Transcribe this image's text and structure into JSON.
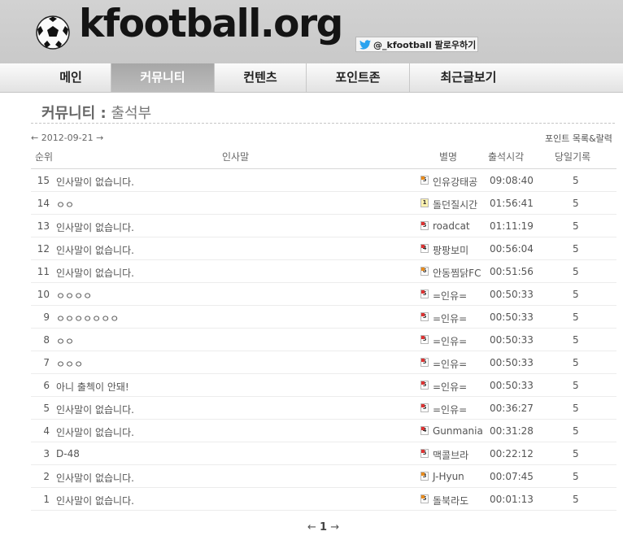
{
  "site": {
    "logo_text": "kfootball.org",
    "twitter_label": "@_kfootball 팔로우하기"
  },
  "nav": [
    {
      "label": "메인",
      "active": false
    },
    {
      "label": "커뮤니티",
      "active": true
    },
    {
      "label": "컨텐츠",
      "active": false
    },
    {
      "label": "포인트존",
      "active": false
    },
    {
      "label": "최근글보기",
      "active": false
    }
  ],
  "page": {
    "title_section": "커뮤니티 :",
    "title_page": "출석부",
    "date_nav": "← 2012-09-21 →",
    "point_link": "포인트 목록&랄력"
  },
  "table": {
    "headers": {
      "rank": "순위",
      "greeting": "인사말",
      "nickname": "별명",
      "time": "출석시각",
      "count": "당일기록"
    },
    "rows": [
      {
        "rank": "15",
        "greeting": "인사말이 없습니다.",
        "level": "5",
        "nickname": "인유강태공",
        "time": "09:08:40",
        "count": "5"
      },
      {
        "rank": "14",
        "greeting": "ㅇㅇ",
        "level": "1",
        "nickname": "돌던질시간",
        "time": "01:56:41",
        "count": "5"
      },
      {
        "rank": "13",
        "greeting": "인사말이 없습니다.",
        "level": "5",
        "nickname": "roadcat",
        "time": "01:11:19",
        "count": "5"
      },
      {
        "rank": "12",
        "greeting": "인사말이 없습니다.",
        "level": "4",
        "nickname": "팡팡보미",
        "time": "00:56:04",
        "count": "5"
      },
      {
        "rank": "11",
        "greeting": "인사말이 없습니다.",
        "level": "6",
        "nickname": "안동찜닭FC",
        "time": "00:51:56",
        "count": "5"
      },
      {
        "rank": "10",
        "greeting": "ㅇㅇㅇㅇ",
        "level": "5",
        "nickname": "=인유=",
        "time": "00:50:33",
        "count": "5"
      },
      {
        "rank": "9",
        "greeting": "ㅇㅇㅇㅇㅇㅇㅇ",
        "level": "5",
        "nickname": "=인유=",
        "time": "00:50:33",
        "count": "5"
      },
      {
        "rank": "8",
        "greeting": "ㅇㅇ",
        "level": "5",
        "nickname": "=인유=",
        "time": "00:50:33",
        "count": "5"
      },
      {
        "rank": "7",
        "greeting": "ㅇㅇㅇ",
        "level": "5",
        "nickname": "=인유=",
        "time": "00:50:33",
        "count": "5"
      },
      {
        "rank": "6",
        "greeting": "아니 출첵이 안돼!",
        "level": "5",
        "nickname": "=인유=",
        "time": "00:50:33",
        "count": "5"
      },
      {
        "rank": "5",
        "greeting": "인사말이 없습니다.",
        "level": "5",
        "nickname": "=인유=",
        "time": "00:36:27",
        "count": "5"
      },
      {
        "rank": "4",
        "greeting": "인사말이 없습니다.",
        "level": "4",
        "nickname": "Gunmania",
        "time": "00:31:28",
        "count": "5"
      },
      {
        "rank": "3",
        "greeting": "D-48",
        "level": "5",
        "nickname": "맥콜브라",
        "time": "00:22:12",
        "count": "5"
      },
      {
        "rank": "2",
        "greeting": "인사말이 없습니다.",
        "level": "3",
        "nickname": "J-Hyun",
        "time": "00:07:45",
        "count": "5"
      },
      {
        "rank": "1",
        "greeting": "인사말이 없습니다.",
        "level": "5",
        "nickname": "돌북라도",
        "time": "00:01:13",
        "count": "5"
      }
    ]
  },
  "pager": {
    "prev": "←",
    "current": "1",
    "next": "→"
  },
  "colors": {
    "header_bg": "#c9c9c9",
    "nav_active": "#b0b0b0",
    "twitter_blue": "#2aa3ef"
  }
}
